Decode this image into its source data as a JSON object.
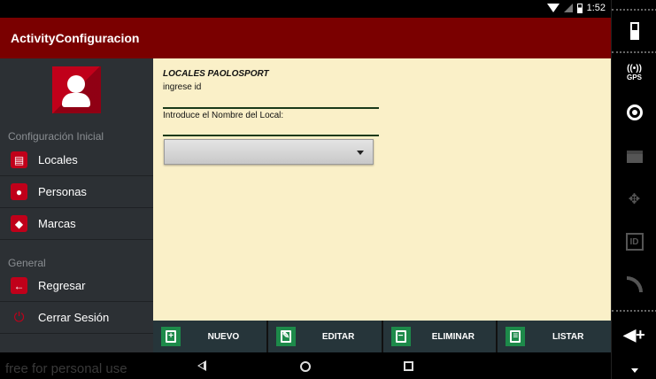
{
  "status_bar": {
    "time": "1:52"
  },
  "app_bar": {
    "title": "ActivityConfiguracion"
  },
  "drawer": {
    "sections": [
      {
        "header": "Configuración Inicial",
        "items": [
          {
            "label": "Locales",
            "icon": "store-icon"
          },
          {
            "label": "Personas",
            "icon": "people-icon"
          },
          {
            "label": "Marcas",
            "icon": "tag-icon"
          }
        ]
      },
      {
        "header": "General",
        "items": [
          {
            "label": "Regresar",
            "icon": "arrow-left-icon"
          },
          {
            "label": "Cerrar Sesión",
            "icon": "power-icon"
          }
        ]
      }
    ]
  },
  "form": {
    "title": "LOCALES PAOLOSPORT",
    "id_label": "ingrese id",
    "id_value": "",
    "name_label": "Introduce el Nombre del Local:",
    "name_value": "",
    "spinner_value": ""
  },
  "buttons": [
    {
      "label": "NUEVO",
      "icon": "add-document-icon"
    },
    {
      "label": "EDITAR",
      "icon": "edit-icon"
    },
    {
      "label": "ELIMINAR",
      "icon": "remove-document-icon"
    },
    {
      "label": "LISTAR",
      "icon": "list-icon"
    }
  ],
  "nav_bar": {
    "watermark": "free for personal use"
  },
  "side_panel": {
    "gps_label": "GPS",
    "id_label": "ID"
  },
  "colors": {
    "app_bar": "#7a0000",
    "drawer": "#2c3034",
    "content": "#faf0c8",
    "accent": "#c0001a",
    "button_icon": "#1d8a4a"
  }
}
